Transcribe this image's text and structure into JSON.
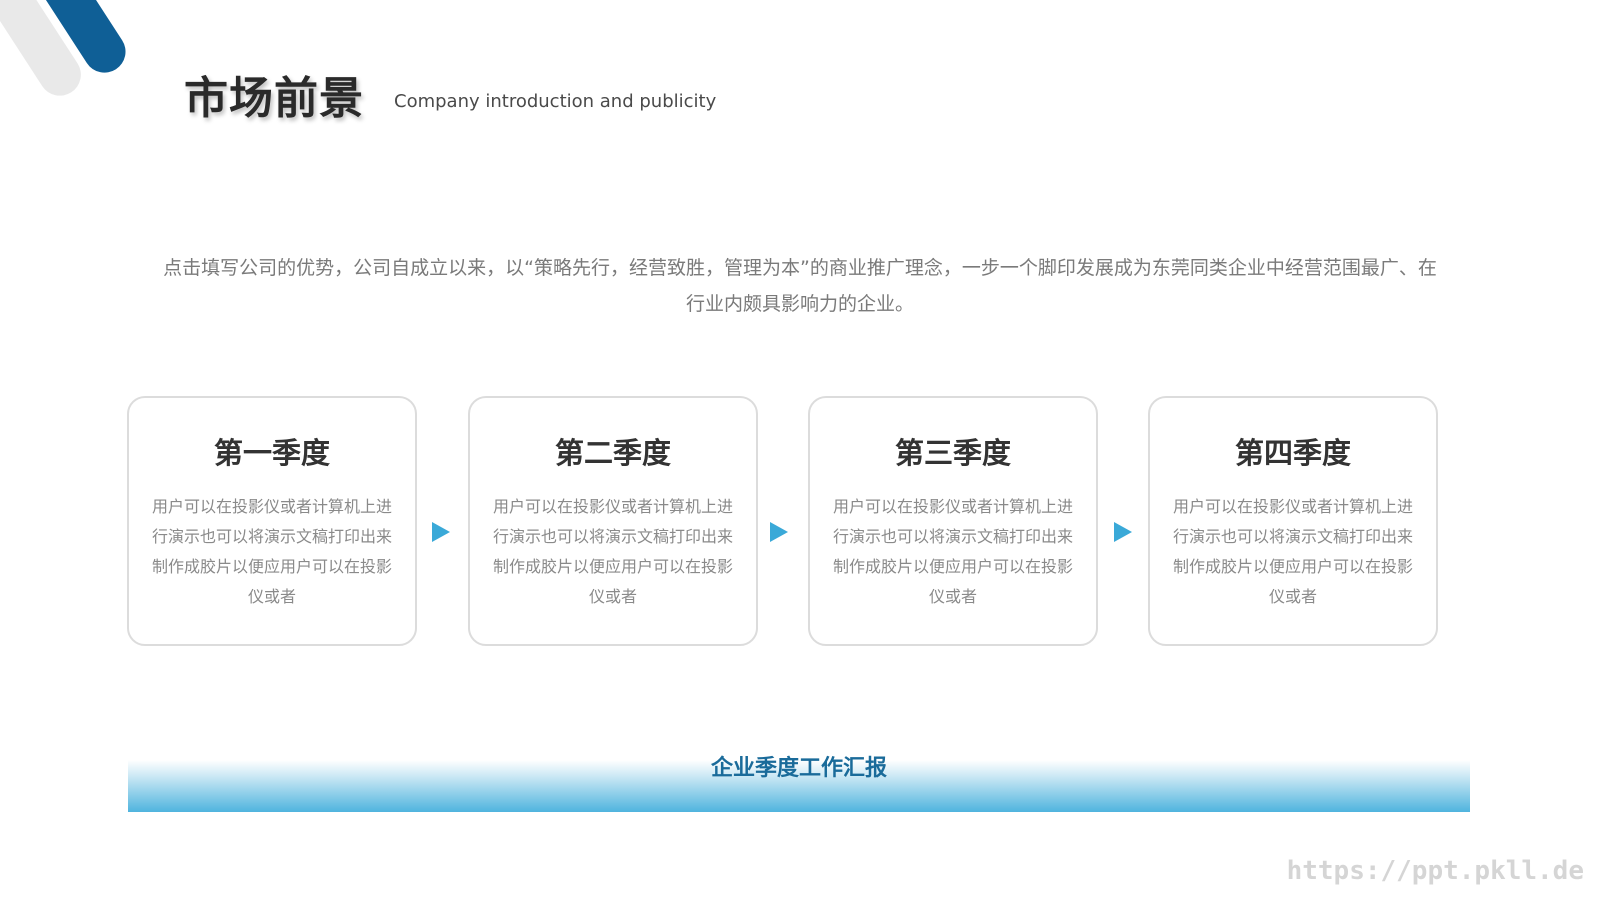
{
  "header": {
    "title": "市场前景",
    "subtitle": "Company introduction and publicity"
  },
  "intro": {
    "text": "点击填写公司的优势，公司自成立以来，以“策略先行，经营致胜，管理为本”的商业推广理念，一步一个脚印发展成为东莞同类企业中经营范围最广、在行业内颇具影响力的企业。"
  },
  "cards": [
    {
      "title": "第一季度",
      "text": "用户可以在投影仪或者计算机上进行演示也可以将演示文稿打印出来制作成胶片以便应用户可以在投影仪或者"
    },
    {
      "title": "第二季度",
      "text": "用户可以在投影仪或者计算机上进行演示也可以将演示文稿打印出来制作成胶片以便应用户可以在投影仪或者"
    },
    {
      "title": "第三季度",
      "text": "用户可以在投影仪或者计算机上进行演示也可以将演示文稿打印出来制作成胶片以便应用户可以在投影仪或者"
    },
    {
      "title": "第四季度",
      "text": "用户可以在投影仪或者计算机上进行演示也可以将演示文稿打印出来制作成胶片以便应用户可以在投影仪或者"
    }
  ],
  "footer": {
    "band_label": "企业季度工作汇报",
    "watermark": "https://ppt.pkll.de"
  },
  "colors": {
    "accent": "#3aa9d8",
    "dark_blue": "#0f5f96",
    "band_text": "#1a6b9a",
    "title": "#2a2a2a"
  },
  "icons": {
    "arrow": "right-triangle-icon",
    "corner": "corner-stripes-decoration"
  }
}
